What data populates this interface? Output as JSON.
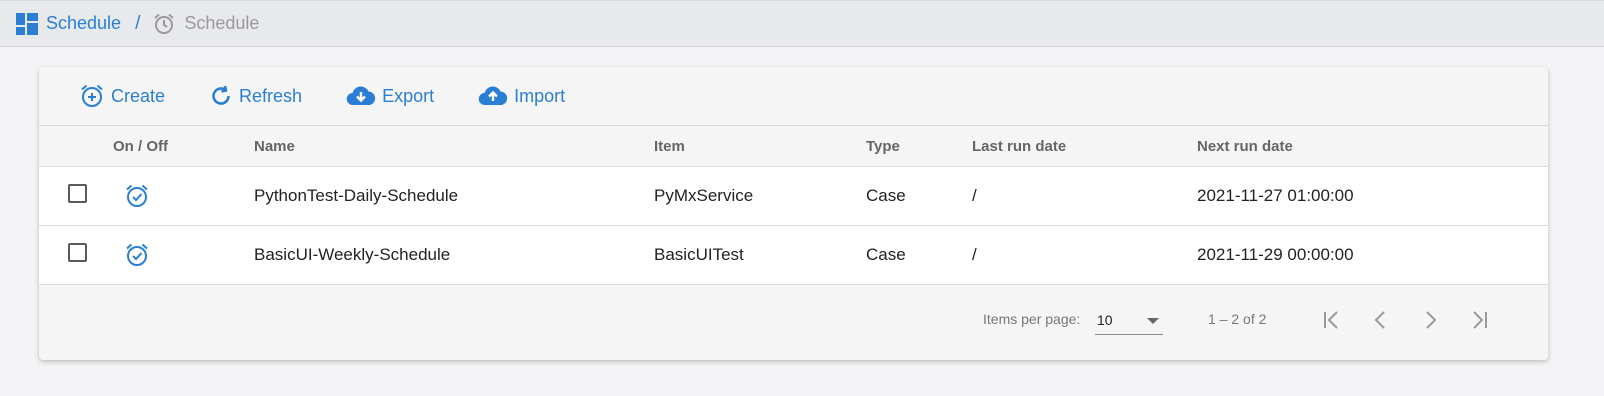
{
  "breadcrumb": {
    "root_label": "Schedule",
    "current_label": "Schedule",
    "separator": "/"
  },
  "toolbar": {
    "create_label": "Create",
    "refresh_label": "Refresh",
    "export_label": "Export",
    "import_label": "Import"
  },
  "table": {
    "headers": {
      "onoff": "On / Off",
      "name": "Name",
      "item": "Item",
      "type": "Type",
      "last_run": "Last run date",
      "next_run": "Next run date"
    },
    "rows": [
      {
        "name": "PythonTest-Daily-Schedule",
        "item": "PyMxService",
        "type": "Case",
        "last_run": "/",
        "next_run": "2021-11-27 01:00:00"
      },
      {
        "name": "BasicUI-Weekly-Schedule",
        "item": "BasicUITest",
        "type": "Case",
        "last_run": "/",
        "next_run": "2021-11-29 00:00:00"
      }
    ]
  },
  "paginator": {
    "items_per_page_label": "Items per page:",
    "items_per_page_value": "10",
    "range_label": "1 – 2 of 2"
  },
  "colors": {
    "accent": "#2a7fd4",
    "topbar": "#e7e9ec",
    "page_bg": "#f4f4f6"
  },
  "icons": {
    "breadcrumb_root": "dashboard-grid-icon",
    "breadcrumb_current": "alarm-clock-icon",
    "create": "alarm-add-icon",
    "refresh": "refresh-icon",
    "export": "cloud-download-icon",
    "import": "cloud-upload-icon",
    "schedule_on": "alarm-on-icon"
  }
}
